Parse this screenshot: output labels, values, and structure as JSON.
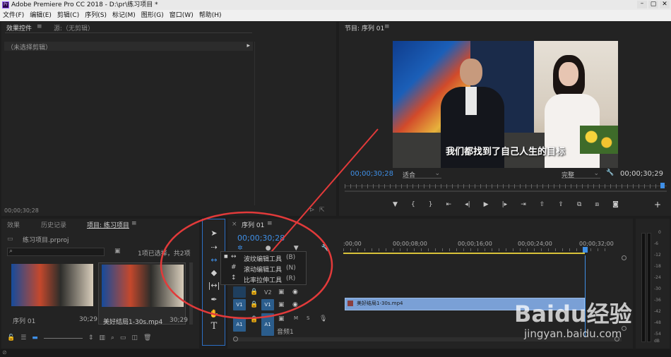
{
  "window": {
    "title": "Adobe Premiere Pro CC 2018 - D:\\pr\\练习项目 *"
  },
  "menu": [
    "文件(F)",
    "编辑(E)",
    "剪辑(C)",
    "序列(S)",
    "标记(M)",
    "图形(G)",
    "窗口(W)",
    "帮助(H)"
  ],
  "effects_panel": {
    "tab1": "效果控件",
    "tab2": "源:（无剪辑）",
    "empty_label": "（未选择剪辑）",
    "timecode": "00;00;30;28"
  },
  "program_monitor": {
    "tab": "节目: 序列 01",
    "subtitle": "我们都找到了自己人生的目标",
    "timecode_left": "00;00;30;28",
    "zoom": "适合",
    "quality": "完整",
    "timecode_right": "00;00;30;29"
  },
  "project_panel": {
    "tabs": [
      "效果",
      "历史记录",
      "项目: 练习项目"
    ],
    "project_file": "练习项目.prproj",
    "selection_info": "1项已选择，共2项",
    "items": [
      {
        "name": "序列 01",
        "duration": "30;29"
      },
      {
        "name": "美好结局1-30s.mp4",
        "duration": "30;29"
      }
    ]
  },
  "tools_flyout": {
    "items": [
      {
        "label": "波纹编辑工具",
        "key": "(B)"
      },
      {
        "label": "滚动编辑工具",
        "key": "(N)"
      },
      {
        "label": "比率拉伸工具",
        "key": "(R)"
      }
    ]
  },
  "timeline": {
    "tab": "序列 01",
    "timecode": "00;00;30;28",
    "ruler": [
      ":00;00",
      "00;00;08;00",
      "00;00;16;00",
      "00;00;24;00",
      "00;00;32;00"
    ],
    "tracks": {
      "v2": "V2",
      "v1": "V1",
      "a1": "A1",
      "audio_name": "音频1",
      "m": "M",
      "s": "S"
    },
    "clip_label": "美好结局1-30s.mp4"
  },
  "audio_meter": {
    "labels": [
      "0",
      "-6",
      "-12",
      "-18",
      "-24",
      "-30",
      "-36",
      "-42",
      "-48",
      "-54"
    ],
    "db": "dB"
  },
  "watermark": {
    "brand": "Baidu经验",
    "url": "jingyan.baidu.com"
  }
}
